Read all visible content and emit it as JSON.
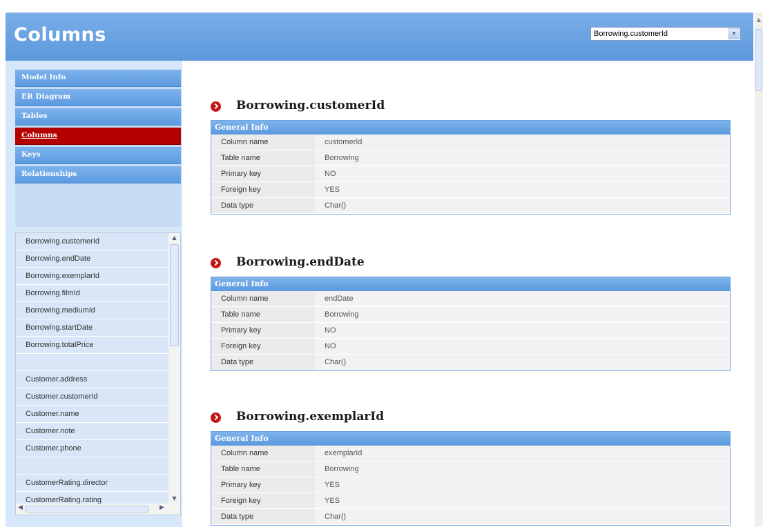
{
  "page_title": "Columns",
  "column_select": {
    "value": "Borrowing.customerId",
    "arrow": "▼"
  },
  "nav": {
    "items": [
      {
        "label": "Model Info",
        "active": false
      },
      {
        "label": "ER Diagram",
        "active": false
      },
      {
        "label": "Tables",
        "active": false
      },
      {
        "label": "Columns",
        "active": true
      },
      {
        "label": "Keys",
        "active": false
      },
      {
        "label": "Relationships",
        "active": false
      }
    ]
  },
  "column_list": {
    "items": [
      "Borrowing.customerId",
      "Borrowing.endDate",
      "Borrowing.exemplarId",
      "Borrowing.filmId",
      "Borrowing.mediumId",
      "Borrowing.startDate",
      "Borrowing.totalPrice",
      "",
      "Customer.address",
      "Customer.customerId",
      "Customer.name",
      "Customer.note",
      "Customer.phone",
      "",
      "CustomerRating.director",
      "CustomerRating.rating"
    ]
  },
  "sections": [
    {
      "title": "Borrowing.customerId",
      "box_title": "General Info",
      "rows": [
        {
          "key": "Column name",
          "value": "customerId"
        },
        {
          "key": "Table name",
          "value": "Borrowing"
        },
        {
          "key": "Primary key",
          "value": "NO"
        },
        {
          "key": "Foreign key",
          "value": "YES"
        },
        {
          "key": "Data type",
          "value": "Char()"
        }
      ]
    },
    {
      "title": "Borrowing.endDate",
      "box_title": "General Info",
      "rows": [
        {
          "key": "Column name",
          "value": "endDate"
        },
        {
          "key": "Table name",
          "value": "Borrowing"
        },
        {
          "key": "Primary key",
          "value": "NO"
        },
        {
          "key": "Foreign key",
          "value": "NO"
        },
        {
          "key": "Data type",
          "value": "Char()"
        }
      ]
    },
    {
      "title": "Borrowing.exemplarId",
      "box_title": "General Info",
      "rows": [
        {
          "key": "Column name",
          "value": "exemplarId"
        },
        {
          "key": "Table name",
          "value": "Borrowing"
        },
        {
          "key": "Primary key",
          "value": "YES"
        },
        {
          "key": "Foreign key",
          "value": "YES"
        },
        {
          "key": "Data type",
          "value": "Char()"
        }
      ]
    }
  ]
}
